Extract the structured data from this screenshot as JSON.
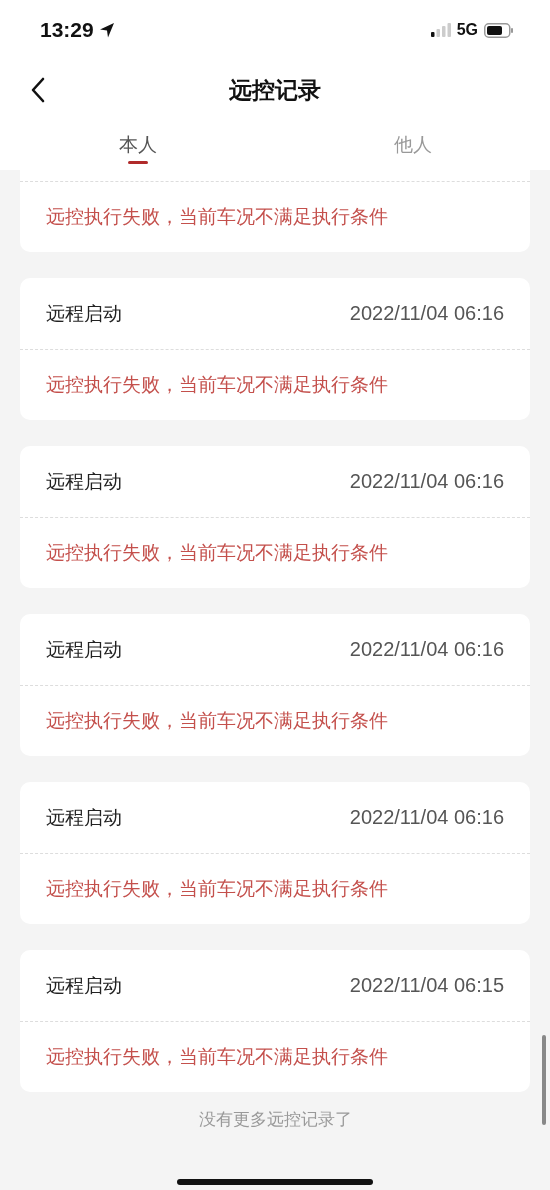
{
  "status_bar": {
    "time": "13:29",
    "network": "5G"
  },
  "nav": {
    "title": "远控记录"
  },
  "tabs": [
    {
      "label": "本人",
      "selected": true
    },
    {
      "label": "他人",
      "selected": false
    }
  ],
  "records": [
    {
      "message": "远控执行失败，当前车况不满足执行条件"
    },
    {
      "action": "远程启动",
      "time": "2022/11/04 06:16",
      "message": "远控执行失败，当前车况不满足执行条件"
    },
    {
      "action": "远程启动",
      "time": "2022/11/04 06:16",
      "message": "远控执行失败，当前车况不满足执行条件"
    },
    {
      "action": "远程启动",
      "time": "2022/11/04 06:16",
      "message": "远控执行失败，当前车况不满足执行条件"
    },
    {
      "action": "远程启动",
      "time": "2022/11/04 06:16",
      "message": "远控执行失败，当前车况不满足执行条件"
    },
    {
      "action": "远程启动",
      "time": "2022/11/04 06:15",
      "message": "远控执行失败，当前车况不满足执行条件"
    }
  ],
  "footer": "没有更多远控记录了"
}
